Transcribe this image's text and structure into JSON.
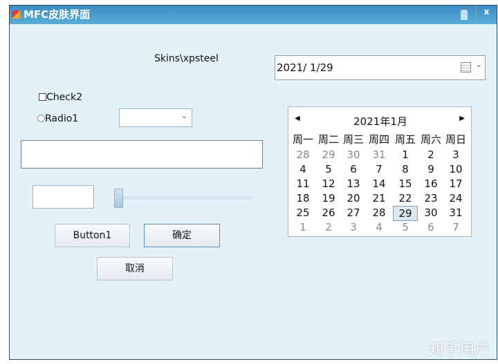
{
  "window": {
    "title": "MFC皮肤界面",
    "close_label": "x"
  },
  "skin_label": "Skins\\xpsteel",
  "checkbox": {
    "label": "Check2",
    "checked": false
  },
  "radio": {
    "label": "Radio1",
    "checked": false
  },
  "combo": {
    "value": ""
  },
  "edit_wide": {
    "value": ""
  },
  "edit_small": {
    "value": ""
  },
  "slider": {
    "value": 0
  },
  "buttons": {
    "button1": "Button1",
    "ok": "确定",
    "cancel": "取消"
  },
  "datepicker": {
    "value": "2021/  1/29"
  },
  "calendar": {
    "month_title": "2021年1月",
    "weekdays": [
      "周一",
      "周二",
      "周三",
      "周四",
      "周五",
      "周六",
      "周日"
    ],
    "weeks": [
      [
        "28",
        "29",
        "30",
        "31",
        "1",
        "2",
        "3"
      ],
      [
        "4",
        "5",
        "6",
        "7",
        "8",
        "9",
        "10"
      ],
      [
        "11",
        "12",
        "13",
        "14",
        "15",
        "16",
        "17"
      ],
      [
        "18",
        "19",
        "20",
        "21",
        "22",
        "23",
        "24"
      ],
      [
        "25",
        "26",
        "27",
        "28",
        "29",
        "30",
        "31"
      ],
      [
        "1",
        "2",
        "3",
        "4",
        "5",
        "6",
        "7"
      ]
    ],
    "selected": "29"
  },
  "watermark": "知乎用户"
}
